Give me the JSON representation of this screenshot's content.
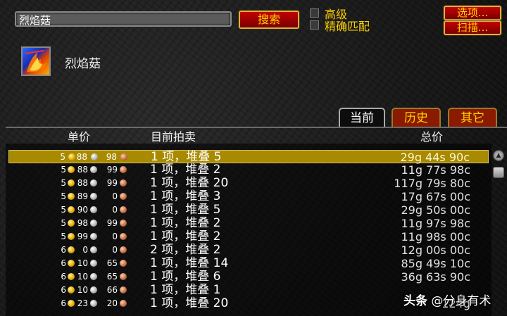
{
  "search": {
    "value": "烈焰菇",
    "button": "搜索"
  },
  "filters": {
    "advanced_label": "高级",
    "exact_label": "精确匹配"
  },
  "side_buttons": {
    "options": "选项...",
    "scan": "扫描..."
  },
  "item": {
    "name": "烈焰菇",
    "icon": "flame-mushroom-icon"
  },
  "tabs": [
    {
      "label": "当前",
      "active": true
    },
    {
      "label": "历史",
      "active": false
    },
    {
      "label": "其它",
      "active": false
    }
  ],
  "columns": {
    "unit_price": "单价",
    "current_auctions": "目前拍卖",
    "total_price": "总价"
  },
  "rows": [
    {
      "g": "5",
      "s": "88",
      "c": "98",
      "listing": "1 项，堆叠 5",
      "total": "29g 44s 90c",
      "selected": true
    },
    {
      "g": "5",
      "s": "88",
      "c": "99",
      "listing": "1 项，堆叠 2",
      "total": "11g 77s 98c"
    },
    {
      "g": "5",
      "s": "88",
      "c": "99",
      "listing": "1 项，堆叠 20",
      "total": "117g 79s 80c"
    },
    {
      "g": "5",
      "s": "89",
      "c": "0",
      "listing": "1 项，堆叠 3",
      "total": "17g 67s 00c"
    },
    {
      "g": "5",
      "s": "90",
      "c": "0",
      "listing": "1 项，堆叠 5",
      "total": "29g 50s 00c"
    },
    {
      "g": "5",
      "s": "98",
      "c": "99",
      "listing": "1 项，堆叠 2",
      "total": "11g 97s 98c"
    },
    {
      "g": "5",
      "s": "99",
      "c": "0",
      "listing": "1 项，堆叠 2",
      "total": "11g 98s 00c"
    },
    {
      "g": "6",
      "s": "0",
      "c": "0",
      "listing": "2 项，堆叠 2",
      "total": "12g 00s 00c"
    },
    {
      "g": "6",
      "s": "10",
      "c": "65",
      "listing": "1 项，堆叠 14",
      "total": "85g 49s 10c"
    },
    {
      "g": "6",
      "s": "10",
      "c": "65",
      "listing": "1 项，堆叠 6",
      "total": "36g 63s 90c"
    },
    {
      "g": "6",
      "s": "10",
      "c": "66",
      "listing": "1 项，堆叠 1",
      "total": ""
    },
    {
      "g": "6",
      "s": "23",
      "c": "20",
      "listing": "1 项，堆叠 20",
      "total": "124g"
    }
  ],
  "watermark": {
    "brand": "头条",
    "handle": "@分身有术"
  },
  "colors": {
    "accent_gold": "#ffd200",
    "button_red": "#c40000",
    "selected_row": "#a88a00"
  }
}
